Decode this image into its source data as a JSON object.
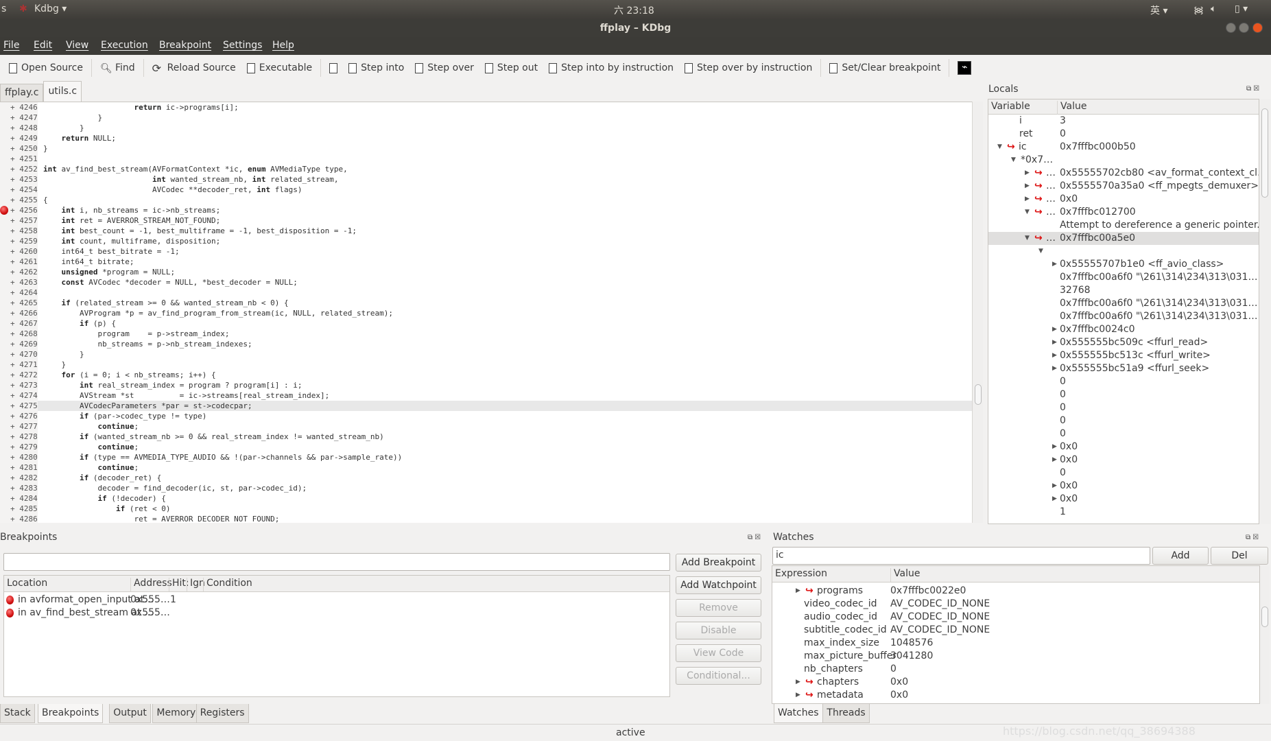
{
  "topbar": {
    "left": "s",
    "app": "Kdbg ▾",
    "clock": "六 23:18",
    "ime": "英 ▾",
    "tray": "wifi volume battery ▾"
  },
  "window": {
    "title": "ffplay – KDbg"
  },
  "menu": [
    "File",
    "Edit",
    "View",
    "Execution",
    "Breakpoint",
    "Settings",
    "Help"
  ],
  "toolbar": [
    {
      "label": "Open Source",
      "icon": "folder-icon"
    },
    {
      "sep": true
    },
    {
      "label": "Find",
      "icon": "search-icon"
    },
    {
      "sep": true
    },
    {
      "label": "Reload Source",
      "icon": "reload-icon"
    },
    {
      "label": "Executable",
      "icon": "folder-icon"
    },
    {
      "sep": true
    },
    {
      "label": "",
      "icon": "run-icon"
    },
    {
      "label": "Step into",
      "icon": "step-into-icon"
    },
    {
      "label": "Step over",
      "icon": "step-over-icon"
    },
    {
      "label": "Step out",
      "icon": "step-out-icon"
    },
    {
      "label": "Step into by instruction",
      "icon": "step-into-instr-icon"
    },
    {
      "label": "Step over by instruction",
      "icon": "step-over-instr-icon"
    },
    {
      "sep": true
    },
    {
      "label": "Set/Clear breakpoint",
      "icon": "document-icon"
    },
    {
      "sep": true
    },
    {
      "label": "",
      "icon": "activity-icon"
    }
  ],
  "source_tabs": [
    {
      "label": "ffplay.c",
      "active": false
    },
    {
      "label": "utils.c",
      "active": true
    }
  ],
  "code": {
    "current_line": 4275,
    "breakpoint_lines": [
      4256
    ],
    "first_line": 4246,
    "lines": [
      "                    return ic->programs[i];",
      "            }",
      "        }",
      "    return NULL;",
      "}",
      "",
      "int av_find_best_stream(AVFormatContext *ic, enum AVMediaType type,",
      "                        int wanted_stream_nb, int related_stream,",
      "                        AVCodec **decoder_ret, int flags)",
      "{",
      "    int i, nb_streams = ic->nb_streams;",
      "    int ret = AVERROR_STREAM_NOT_FOUND;",
      "    int best_count = -1, best_multiframe = -1, best_disposition = -1;",
      "    int count, multiframe, disposition;",
      "    int64_t best_bitrate = -1;",
      "    int64_t bitrate;",
      "    unsigned *program = NULL;",
      "    const AVCodec *decoder = NULL, *best_decoder = NULL;",
      "",
      "    if (related_stream >= 0 && wanted_stream_nb < 0) {",
      "        AVProgram *p = av_find_program_from_stream(ic, NULL, related_stream);",
      "        if (p) {",
      "            program    = p->stream_index;",
      "            nb_streams = p->nb_stream_indexes;",
      "        }",
      "    }",
      "    for (i = 0; i < nb_streams; i++) {",
      "        int real_stream_index = program ? program[i] : i;",
      "        AVStream *st          = ic->streams[real_stream_index];",
      "        AVCodecParameters *par = st->codecpar;",
      "        if (par->codec_type != type)",
      "            continue;",
      "        if (wanted_stream_nb >= 0 && real_stream_index != wanted_stream_nb)",
      "            continue;",
      "        if (type == AVMEDIA_TYPE_AUDIO && !(par->channels && par->sample_rate))",
      "            continue;",
      "        if (decoder_ret) {",
      "            decoder = find_decoder(ic, st, par->codec_id);",
      "            if (!decoder) {",
      "                if (ret < 0)",
      "                    ret = AVERROR_DECODER_NOT_FOUND;"
    ]
  },
  "locals": {
    "title": "Locals",
    "columns": [
      "Variable",
      "Value"
    ],
    "rows": [
      {
        "lvl": 1,
        "tog": "",
        "ptr": false,
        "name": "i",
        "value": "3"
      },
      {
        "lvl": 1,
        "tog": "",
        "ptr": false,
        "name": "ret",
        "value": "0"
      },
      {
        "lvl": 0,
        "tog": "open",
        "ptr": true,
        "name": "ic",
        "value": "0x7fffbc000b50"
      },
      {
        "lvl": 1,
        "tog": "open",
        "ptr": false,
        "name": "*0x7…",
        "value": ""
      },
      {
        "lvl": 2,
        "tog": "closed",
        "ptr": true,
        "name": "…",
        "value": "0x55555702cb80 <av_format_context_cl…"
      },
      {
        "lvl": 2,
        "tog": "closed",
        "ptr": true,
        "name": "…",
        "value": "0x5555570a35a0 <ff_mpegts_demuxer>"
      },
      {
        "lvl": 2,
        "tog": "closed",
        "ptr": true,
        "name": "…",
        "value": "0x0"
      },
      {
        "lvl": 2,
        "tog": "open",
        "ptr": true,
        "name": "…",
        "value": "0x7fffbc012700"
      },
      {
        "lvl": 3,
        "tog": "",
        "ptr": false,
        "name": "",
        "value": "Attempt to dereference a generic pointer."
      },
      {
        "lvl": 2,
        "tog": "open",
        "ptr": true,
        "name": "…",
        "value": "0x7fffbc00a5e0",
        "selected": true
      },
      {
        "lvl": 3,
        "tog": "open",
        "ptr": false,
        "name": "",
        "value": ""
      },
      {
        "lvl": 4,
        "tog": "closed",
        "ptr": false,
        "name": "",
        "value": "0x55555707b1e0 <ff_avio_class>"
      },
      {
        "lvl": 4,
        "tog": "",
        "ptr": false,
        "name": "",
        "value": "0x7fffbc00a6f0 \"\\261\\314\\234\\313\\031…"
      },
      {
        "lvl": 4,
        "tog": "",
        "ptr": false,
        "name": "",
        "value": "32768"
      },
      {
        "lvl": 4,
        "tog": "",
        "ptr": false,
        "name": "",
        "value": "0x7fffbc00a6f0 \"\\261\\314\\234\\313\\031…"
      },
      {
        "lvl": 4,
        "tog": "",
        "ptr": false,
        "name": "",
        "value": "0x7fffbc00a6f0 \"\\261\\314\\234\\313\\031…"
      },
      {
        "lvl": 4,
        "tog": "closed",
        "ptr": false,
        "name": "",
        "value": "0x7fffbc0024c0"
      },
      {
        "lvl": 4,
        "tog": "closed",
        "ptr": false,
        "name": "",
        "value": "0x555555bc509c <ffurl_read>"
      },
      {
        "lvl": 4,
        "tog": "closed",
        "ptr": false,
        "name": "",
        "value": "0x555555bc513c <ffurl_write>"
      },
      {
        "lvl": 4,
        "tog": "closed",
        "ptr": false,
        "name": "",
        "value": "0x555555bc51a9 <ffurl_seek>"
      },
      {
        "lvl": 4,
        "tog": "",
        "ptr": false,
        "name": "",
        "value": "0"
      },
      {
        "lvl": 4,
        "tog": "",
        "ptr": false,
        "name": "",
        "value": "0"
      },
      {
        "lvl": 4,
        "tog": "",
        "ptr": false,
        "name": "",
        "value": "0"
      },
      {
        "lvl": 4,
        "tog": "",
        "ptr": false,
        "name": "",
        "value": "0"
      },
      {
        "lvl": 4,
        "tog": "",
        "ptr": false,
        "name": "",
        "value": "0"
      },
      {
        "lvl": 4,
        "tog": "closed",
        "ptr": false,
        "name": "",
        "value": "0x0"
      },
      {
        "lvl": 4,
        "tog": "closed",
        "ptr": false,
        "name": "",
        "value": "0x0"
      },
      {
        "lvl": 4,
        "tog": "",
        "ptr": false,
        "name": "",
        "value": "0"
      },
      {
        "lvl": 4,
        "tog": "closed",
        "ptr": false,
        "name": "",
        "value": "0x0"
      },
      {
        "lvl": 4,
        "tog": "closed",
        "ptr": false,
        "name": "",
        "value": "0x0"
      },
      {
        "lvl": 4,
        "tog": "",
        "ptr": false,
        "name": "",
        "value": "1"
      }
    ]
  },
  "breakpoints": {
    "title": "Breakpoints",
    "input": "",
    "columns": [
      "Location",
      "Address",
      "Hit:",
      "Ign",
      "Condition"
    ],
    "rows": [
      {
        "location": "in avformat_open_input at…",
        "address": "0x555…",
        "hits": "1"
      },
      {
        "location": "in av_find_best_stream at …",
        "address": "0x555…",
        "hits": ""
      }
    ],
    "buttons": [
      {
        "label": "Add Breakpoint",
        "enabled": true
      },
      {
        "label": "Add Watchpoint",
        "enabled": true
      },
      {
        "label": "Remove",
        "enabled": false
      },
      {
        "label": "Disable",
        "enabled": false
      },
      {
        "label": "View Code",
        "enabled": false
      },
      {
        "label": "Conditional...",
        "enabled": false
      }
    ],
    "tabs": [
      {
        "label": "Stack"
      },
      {
        "label": "Breakpoints",
        "active": true
      },
      {
        "label": "Output"
      },
      {
        "label": "Memory"
      },
      {
        "label": "Registers"
      }
    ]
  },
  "watches": {
    "title": "Watches",
    "input": "ic",
    "add": "Add",
    "del": "Del",
    "columns": [
      "Expression",
      "Value"
    ],
    "rows": [
      {
        "tog": "closed",
        "ptr": true,
        "name": "programs",
        "value": "0x7fffbc0022e0"
      },
      {
        "tog": "",
        "ptr": false,
        "name": "video_codec_id",
        "value": "AV_CODEC_ID_NONE"
      },
      {
        "tog": "",
        "ptr": false,
        "name": "audio_codec_id",
        "value": "AV_CODEC_ID_NONE"
      },
      {
        "tog": "",
        "ptr": false,
        "name": "subtitle_codec_id",
        "value": "AV_CODEC_ID_NONE"
      },
      {
        "tog": "",
        "ptr": false,
        "name": "max_index_size",
        "value": "1048576"
      },
      {
        "tog": "",
        "ptr": false,
        "name": "max_picture_buffer",
        "value": "3041280"
      },
      {
        "tog": "",
        "ptr": false,
        "name": "nb_chapters",
        "value": "0"
      },
      {
        "tog": "closed",
        "ptr": true,
        "name": "chapters",
        "value": "0x0"
      },
      {
        "tog": "closed",
        "ptr": true,
        "name": "metadata",
        "value": "0x0"
      }
    ],
    "tabs": [
      {
        "label": "Watches",
        "active": true
      },
      {
        "label": "Threads"
      }
    ]
  },
  "status": {
    "text": "active",
    "watermark": "https://blog.csdn.net/qq_38694388"
  },
  "colors": {
    "topbar": "#3c3b37",
    "breakpoint": "#d01010",
    "pointer_arrow": "#dd1111",
    "close_button": "#e9541f"
  }
}
